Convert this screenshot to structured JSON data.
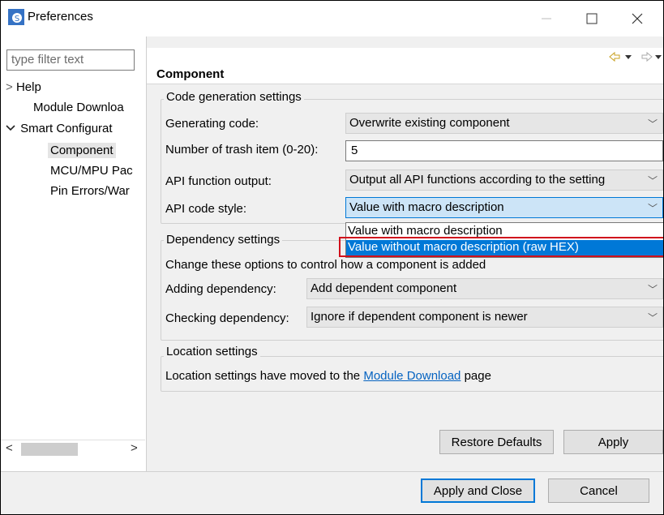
{
  "window": {
    "title": "Preferences"
  },
  "sidebar": {
    "filter_placeholder": "type filter text",
    "items": [
      {
        "label": "Help",
        "expander": ">"
      },
      {
        "label": "Module Downloa"
      },
      {
        "label": "Smart Configurat",
        "expander": "✓"
      },
      {
        "label": "Component"
      },
      {
        "label": "MCU/MPU Pac"
      },
      {
        "label": "Pin Errors/War"
      }
    ]
  },
  "header": {
    "title": "Component"
  },
  "code_gen": {
    "title": "Code generation settings",
    "generating_label": "Generating code:",
    "generating_value": "Overwrite existing component",
    "trash_label": "Number of trash item (0-20):",
    "trash_value": "5",
    "api_output_label": "API function output:",
    "api_output_value": "Output all API functions according to the setting",
    "api_style_label": "API code style:",
    "api_style_value": "Value with macro description"
  },
  "dropdown": {
    "options": [
      "Value with macro description",
      "Value without macro description (raw HEX)"
    ],
    "selected_index": 1
  },
  "dependency": {
    "title": "Dependency settings",
    "description": "Change these options to control how a component is added",
    "adding_label": "Adding dependency:",
    "adding_value": "Add dependent component",
    "checking_label": "Checking dependency:",
    "checking_value": "Ignore if dependent component is newer"
  },
  "location": {
    "title": "Location settings",
    "text_before": "Location settings have moved to the ",
    "link": "Module Download",
    "text_after": " page"
  },
  "buttons": {
    "restore": "Restore Defaults",
    "apply": "Apply",
    "apply_close": "Apply and Close",
    "cancel": "Cancel"
  },
  "colors": {
    "selection": "#0078d7",
    "highlight_box": "#d0101c",
    "link": "#0563c1"
  }
}
